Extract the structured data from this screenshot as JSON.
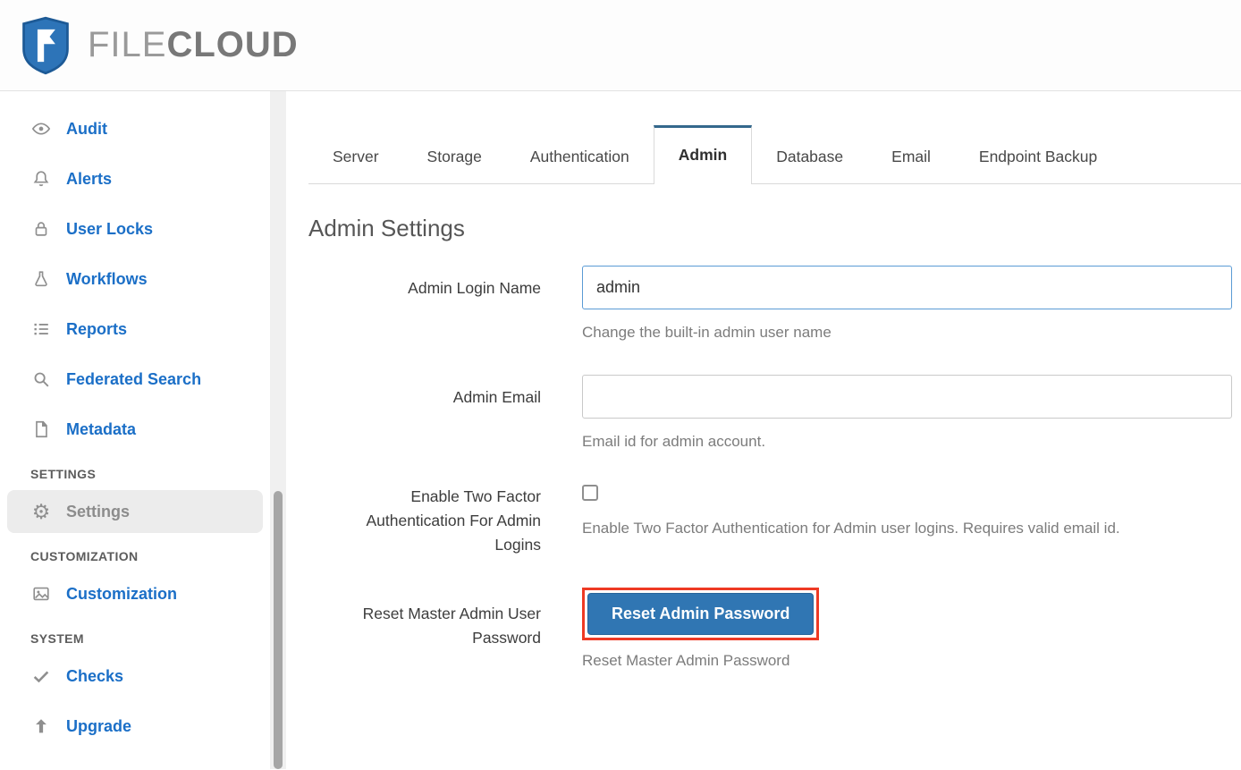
{
  "header": {
    "brand_file": "FILE",
    "brand_cloud": "CLOUD"
  },
  "sidebar": {
    "items": [
      {
        "label": "Audit",
        "icon": "eye-icon"
      },
      {
        "label": "Alerts",
        "icon": "bell-icon"
      },
      {
        "label": "User Locks",
        "icon": "lock-icon"
      },
      {
        "label": "Workflows",
        "icon": "flask-icon"
      },
      {
        "label": "Reports",
        "icon": "list-icon"
      },
      {
        "label": "Federated Search",
        "icon": "search-icon"
      },
      {
        "label": "Metadata",
        "icon": "file-icon"
      }
    ],
    "settings_section": "SETTINGS",
    "settings_item": "Settings",
    "customization_section": "CUSTOMIZATION",
    "customization_item": "Customization",
    "system_section": "SYSTEM",
    "checks_item": "Checks",
    "upgrade_item": "Upgrade"
  },
  "tabs": [
    {
      "label": "Server",
      "active": false
    },
    {
      "label": "Storage",
      "active": false
    },
    {
      "label": "Authentication",
      "active": false
    },
    {
      "label": "Admin",
      "active": true
    },
    {
      "label": "Database",
      "active": false
    },
    {
      "label": "Email",
      "active": false
    },
    {
      "label": "Endpoint Backup",
      "active": false
    }
  ],
  "page": {
    "title": "Admin Settings"
  },
  "form": {
    "admin_login": {
      "label": "Admin Login Name",
      "value": "admin",
      "help": "Change the built-in admin user name"
    },
    "admin_email": {
      "label": "Admin Email",
      "value": "",
      "help": "Email id for admin account."
    },
    "two_factor": {
      "label": "Enable Two Factor Authentication For Admin Logins",
      "checked": false,
      "help": "Enable Two Factor Authentication for Admin user logins. Requires valid email id."
    },
    "reset": {
      "label": "Reset Master Admin User Password",
      "button_label": "Reset Admin Password",
      "help": "Reset Master Admin Password"
    }
  },
  "colors": {
    "sidebar_link_blue": "#1b6fc7",
    "active_tab_border": "#34688c",
    "button_blue": "#3076b3",
    "highlight_red": "#ee3a24",
    "focused_input_border": "#5b9bd5",
    "logo_blue": "#2d74b8"
  }
}
